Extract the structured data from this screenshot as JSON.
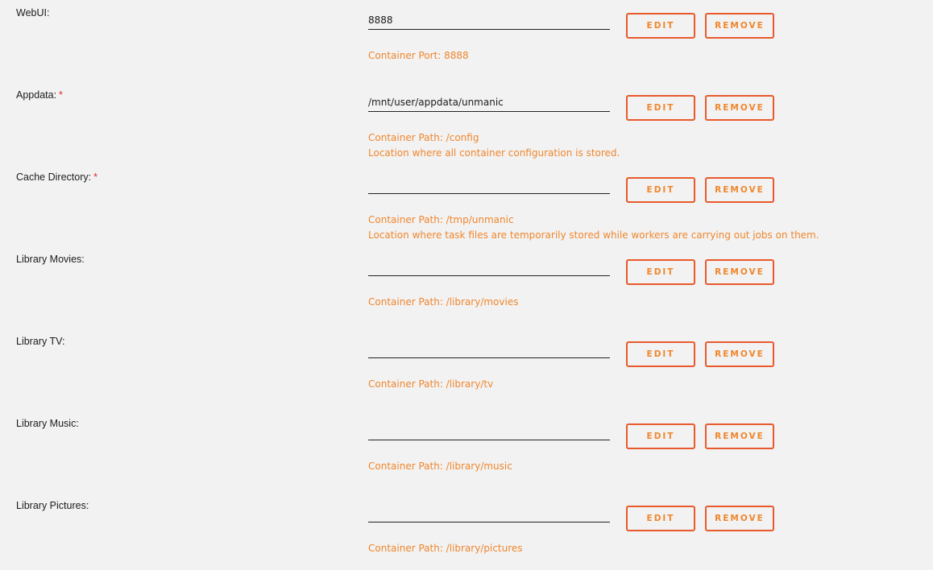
{
  "colors": {
    "background": "#f2f2f2",
    "accent": "#f0862c",
    "button_border": "#e85a2c",
    "required": "#e22828",
    "text": "#1c1c1c"
  },
  "buttons": {
    "edit_label": "EDIT",
    "remove_label": "REMOVE"
  },
  "required_marker": "*",
  "fields": [
    {
      "label": "WebUI:",
      "required": false,
      "value": "8888",
      "desc_line1": "Container Port: 8888",
      "desc_line2": ""
    },
    {
      "label": "Appdata:",
      "required": true,
      "value": "/mnt/user/appdata/unmanic",
      "desc_line1": "Container Path: /config",
      "desc_line2": "Location where all container configuration is stored."
    },
    {
      "label": "Cache Directory:",
      "required": true,
      "value": "",
      "desc_line1": "Container Path: /tmp/unmanic",
      "desc_line2": "Location where task files are temporarily stored while workers are carrying out jobs on them."
    },
    {
      "label": "Library Movies:",
      "required": false,
      "value": "",
      "desc_line1": "Container Path: /library/movies",
      "desc_line2": ""
    },
    {
      "label": "Library TV:",
      "required": false,
      "value": "",
      "desc_line1": "Container Path: /library/tv",
      "desc_line2": ""
    },
    {
      "label": "Library Music:",
      "required": false,
      "value": "",
      "desc_line1": "Container Path: /library/music",
      "desc_line2": ""
    },
    {
      "label": "Library Pictures:",
      "required": false,
      "value": "",
      "desc_line1": "Container Path: /library/pictures",
      "desc_line2": ""
    }
  ]
}
